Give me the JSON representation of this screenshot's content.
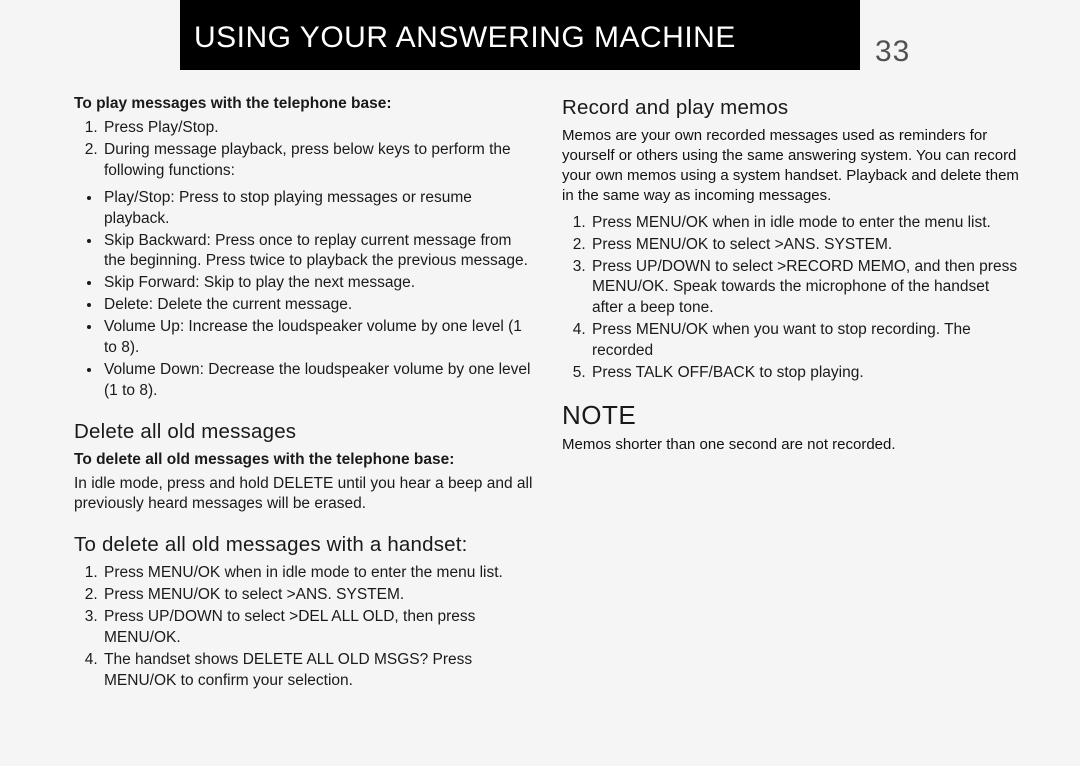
{
  "header": {
    "title": "USING YOUR ANSWERING MACHINE",
    "page_number": "33"
  },
  "left": {
    "lead": "To play messages with the telephone base:",
    "ol1": [
      "Press Play/Stop.",
      "During message playback, press below keys to perform the following functions:"
    ],
    "ul1": [
      "Play/Stop: Press to stop playing messages or resume playback.",
      "Skip Backward: Press once to replay current message from the beginning. Press twice to playback the previous message.",
      "Skip Forward: Skip to play the next message.",
      "Delete: Delete the current message.",
      "Volume Up: Increase the loudspeaker volume by one level (1 to 8).",
      "Volume Down: Decrease the loudspeaker volume by one level (1 to 8)."
    ],
    "h2": "Delete all old messages",
    "lead2": "To delete all old messages with the telephone base:",
    "p2": "In idle mode, press and hold DELETE until you hear a beep and all previously heard messages will be erased.",
    "h3": "To delete all old messages with a handset:",
    "ol3": [
      "Press MENU/OK when in idle mode to enter the menu list.",
      "Press MENU/OK to select >ANS. SYSTEM.",
      "Press UP/DOWN to select >DEL ALL OLD, then press MENU/OK.",
      "The handset shows DELETE ALL OLD MSGS? Press MENU/OK to confirm your selection."
    ]
  },
  "right": {
    "h1": "Record and play memos",
    "p1": "Memos are your own recorded messages used as reminders for yourself or others using the same answering system. You can record your own memos using a system handset. Playback and delete them in the same way as incoming messages.",
    "ol1": [
      "Press MENU/OK when in idle mode to enter the menu list.",
      "Press MENU/OK to select >ANS. SYSTEM.",
      "Press UP/DOWN to select >RECORD MEMO, and then press MENU/OK. Speak towards the microphone of the handset after a beep tone.",
      "Press MENU/OK when you want to stop recording. The recorded",
      "Press TALK OFF/BACK to stop playing."
    ],
    "note_h": "NOTE",
    "note_p": "Memos shorter than one second are not recorded."
  }
}
